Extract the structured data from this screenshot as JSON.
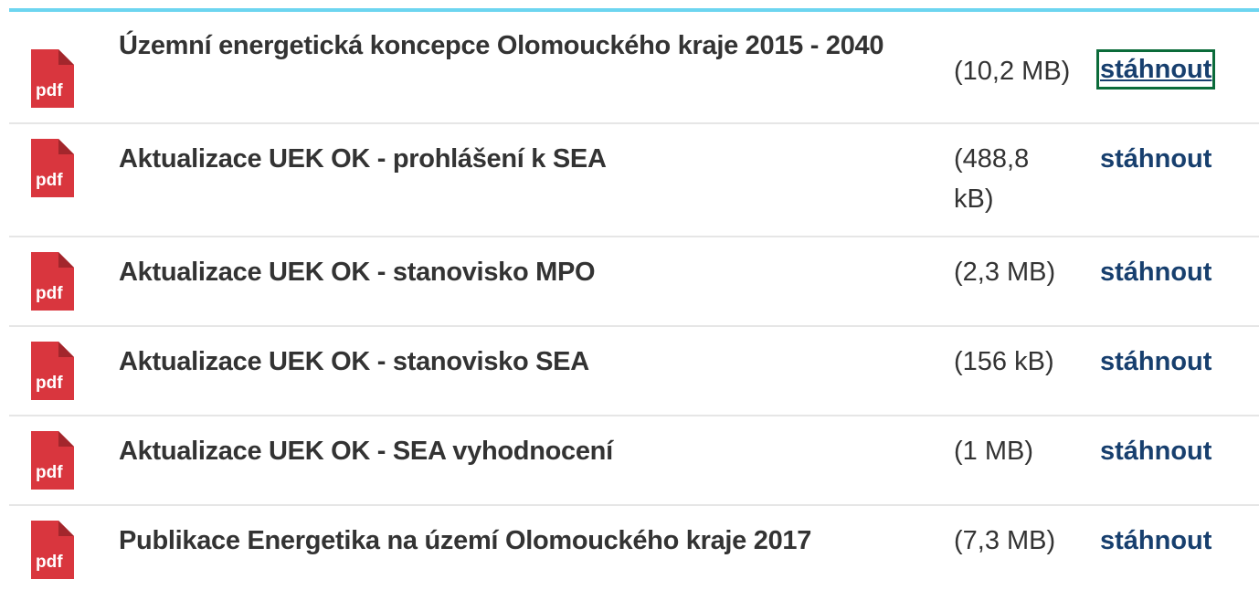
{
  "files": [
    {
      "title": "Územní energetická koncepce Olomouckého kraje 2015 - 2040",
      "size": "(10,2 MB)",
      "download": "stáhnout",
      "icon": "pdf-icon",
      "icon_label": "pdf"
    },
    {
      "title": "Aktualizace UEK OK - prohlášení k SEA",
      "size": "(488,8 kB)",
      "download": "stáhnout",
      "icon": "pdf-icon",
      "icon_label": "pdf"
    },
    {
      "title": "Aktualizace UEK OK - stanovisko MPO",
      "size": "(2,3 MB)",
      "download": "stáhnout",
      "icon": "pdf-icon",
      "icon_label": "pdf"
    },
    {
      "title": "Aktualizace UEK OK - stanovisko SEA",
      "size": "(156 kB)",
      "download": "stáhnout",
      "icon": "pdf-icon",
      "icon_label": "pdf"
    },
    {
      "title": "Aktualizace UEK OK - SEA vyhodnocení",
      "size": "(1 MB)",
      "download": "stáhnout",
      "icon": "pdf-icon",
      "icon_label": "pdf"
    },
    {
      "title": "Publikace Energetika na území Olomouckého kraje 2017",
      "size": "(7,3 MB)",
      "download": "stáhnout",
      "icon": "pdf-icon",
      "icon_label": "pdf"
    }
  ],
  "colors": {
    "accent_bar": "#6dd5f0",
    "pdf_red": "#d9363e",
    "link": "#173f6e",
    "focus_outline": "#0b6b3a"
  }
}
